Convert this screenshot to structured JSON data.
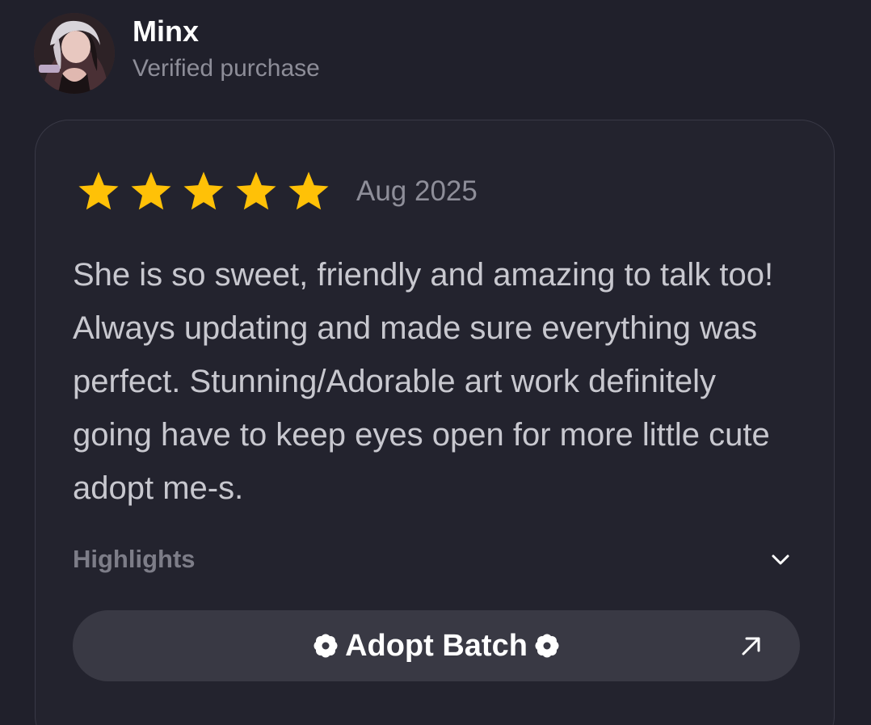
{
  "reviewer": {
    "name": "Minx",
    "status": "Verified purchase",
    "avatar_icon": "avatar-image"
  },
  "review": {
    "rating": 5,
    "rating_max": 5,
    "date": "Aug 2025",
    "text": "She is so sweet, friendly and amazing to talk too! Always updating and made sure everything was perfect. Stunning/Adorable art work definitely going have to keep eyes open for more little cute adopt me-s."
  },
  "highlights": {
    "label": "Highlights",
    "icon": "chevron-down-icon"
  },
  "product_link": {
    "label": "Adopt Batch",
    "icon_left": "flower-icon",
    "icon_right": "flower-icon",
    "action_icon": "arrow-up-right-icon"
  },
  "colors": {
    "background": "#20202b",
    "card_background": "#23232e",
    "card_border": "#393946",
    "star": "#ffc107",
    "primary_text": "#ffffff",
    "secondary_text": "#8d8d98",
    "body_text": "#c8c8cf",
    "button_background": "#393944"
  }
}
